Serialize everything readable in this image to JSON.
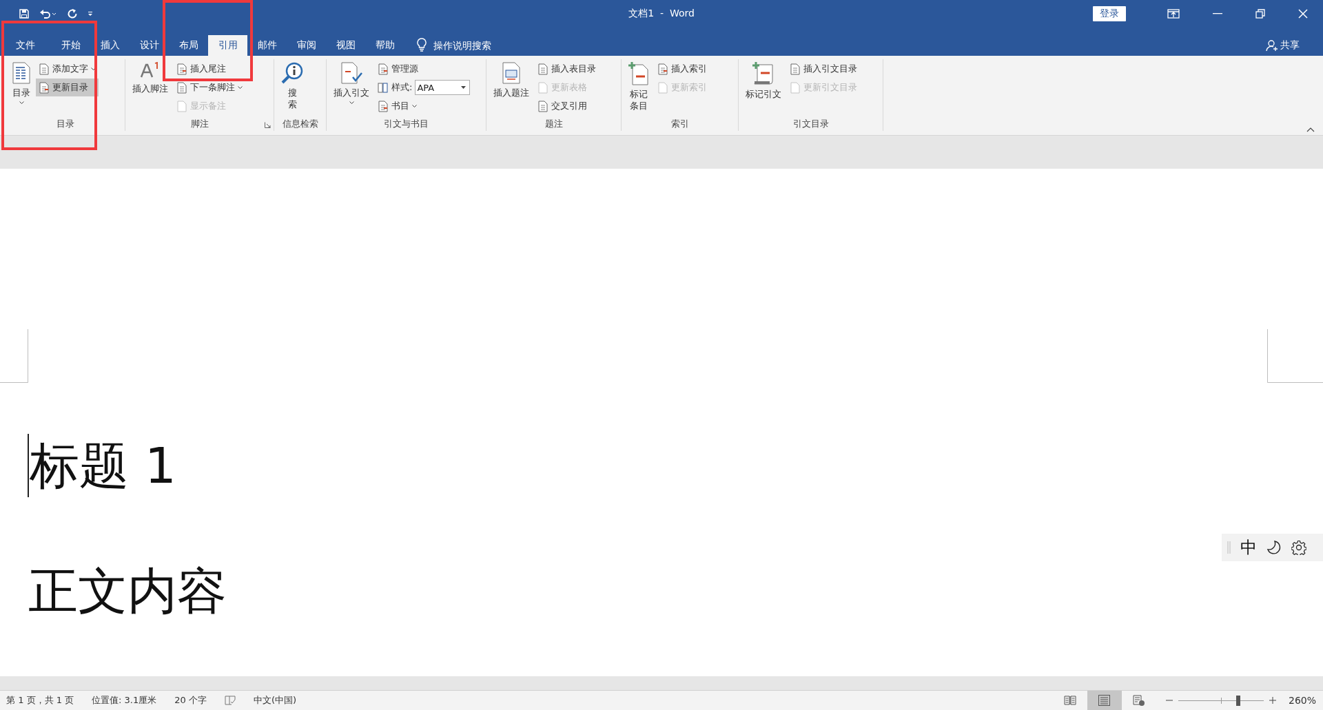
{
  "window": {
    "title": "文档1  -  Word",
    "sign_in": "登录"
  },
  "tabs": [
    {
      "label": "文件",
      "selected": false
    },
    {
      "label": "开始",
      "selected": false
    },
    {
      "label": "插入",
      "selected": false
    },
    {
      "label": "设计",
      "selected": false
    },
    {
      "label": "布局",
      "selected": false
    },
    {
      "label": "引用",
      "selected": true
    },
    {
      "label": "邮件",
      "selected": false
    },
    {
      "label": "审阅",
      "selected": false
    },
    {
      "label": "视图",
      "selected": false
    },
    {
      "label": "帮助",
      "selected": false
    }
  ],
  "tell_me": "操作说明搜索",
  "share": "共享",
  "ribbon": {
    "groups": [
      {
        "label": "目录",
        "launcher": false,
        "controls": [
          {
            "kind": "large",
            "label_lines": [
              "目录"
            ],
            "dropdown": true
          },
          {
            "kind": "stack",
            "items": [
              {
                "kind": "button",
                "label": "添加文字",
                "dropdown": true,
                "disabled": false,
                "hovered": false
              },
              {
                "kind": "button",
                "label": "更新目录",
                "dropdown": false,
                "disabled": false,
                "hovered": true
              }
            ]
          }
        ]
      },
      {
        "label": "脚注",
        "launcher": true,
        "controls": [
          {
            "kind": "large",
            "label_lines": [
              "插入脚注"
            ],
            "dropdown": false
          },
          {
            "kind": "stack",
            "items": [
              {
                "kind": "button",
                "label": "插入尾注",
                "dropdown": false,
                "disabled": false,
                "hovered": false
              },
              {
                "kind": "button",
                "label": "下一条脚注",
                "dropdown": true,
                "disabled": false,
                "hovered": false
              },
              {
                "kind": "button",
                "label": "显示备注",
                "dropdown": false,
                "disabled": true,
                "hovered": false
              }
            ]
          }
        ]
      },
      {
        "label": "信息检索",
        "launcher": false,
        "controls": [
          {
            "kind": "large",
            "label_lines": [
              "搜",
              "索"
            ],
            "dropdown": false
          }
        ]
      },
      {
        "label": "引文与书目",
        "launcher": false,
        "controls": [
          {
            "kind": "large",
            "label_lines": [
              "插入引文"
            ],
            "dropdown": true
          },
          {
            "kind": "stack",
            "items": [
              {
                "kind": "button",
                "label": "管理源",
                "dropdown": false,
                "disabled": false,
                "hovered": false
              },
              {
                "kind": "select",
                "label": "样式:",
                "value": "APA",
                "dropdown": true,
                "disabled": false,
                "hovered": false
              },
              {
                "kind": "button",
                "label": "书目",
                "dropdown": true,
                "disabled": false,
                "hovered": false
              }
            ]
          }
        ]
      },
      {
        "label": "题注",
        "launcher": false,
        "controls": [
          {
            "kind": "large",
            "label_lines": [
              "插入题注"
            ],
            "dropdown": false
          },
          {
            "kind": "stack",
            "items": [
              {
                "kind": "button",
                "label": "插入表目录",
                "dropdown": false,
                "disabled": false,
                "hovered": false
              },
              {
                "kind": "button",
                "label": "更新表格",
                "dropdown": false,
                "disabled": true,
                "hovered": false
              },
              {
                "kind": "button",
                "label": "交叉引用",
                "dropdown": false,
                "disabled": false,
                "hovered": false
              }
            ]
          }
        ]
      },
      {
        "label": "索引",
        "launcher": false,
        "controls": [
          {
            "kind": "large",
            "label_lines": [
              "标记",
              "条目"
            ],
            "dropdown": false
          },
          {
            "kind": "stack",
            "items": [
              {
                "kind": "button",
                "label": "插入索引",
                "dropdown": false,
                "disabled": false,
                "hovered": false
              },
              {
                "kind": "button",
                "label": "更新索引",
                "dropdown": false,
                "disabled": true,
                "hovered": false
              }
            ]
          }
        ]
      },
      {
        "label": "引文目录",
        "launcher": false,
        "controls": [
          {
            "kind": "large",
            "label_lines": [
              "标记引文"
            ],
            "dropdown": false
          },
          {
            "kind": "stack",
            "items": [
              {
                "kind": "button",
                "label": "插入引文目录",
                "dropdown": false,
                "disabled": false,
                "hovered": false
              },
              {
                "kind": "button",
                "label": "更新引文目录",
                "dropdown": false,
                "disabled": true,
                "hovered": false
              }
            ]
          }
        ]
      }
    ]
  },
  "document": {
    "heading": "标题 1",
    "body": "正文内容"
  },
  "ime_bar": {
    "mode": "中"
  },
  "status_bar": {
    "items": [
      {
        "kind": "text",
        "text": "第 1 页，共 1 页"
      },
      {
        "kind": "text",
        "text": "位置值: 3.1厘米"
      },
      {
        "kind": "text",
        "text": "20 个字"
      },
      {
        "kind": "proofing"
      },
      {
        "kind": "text",
        "text": "中文(中国)"
      }
    ],
    "views": [
      {
        "selected": false
      },
      {
        "selected": true
      },
      {
        "selected": false
      }
    ],
    "zoom": {
      "level": 0.7,
      "reading": "260%"
    }
  },
  "annotations": [
    {
      "kind": "frame"
    },
    {
      "kind": "frame"
    }
  ]
}
